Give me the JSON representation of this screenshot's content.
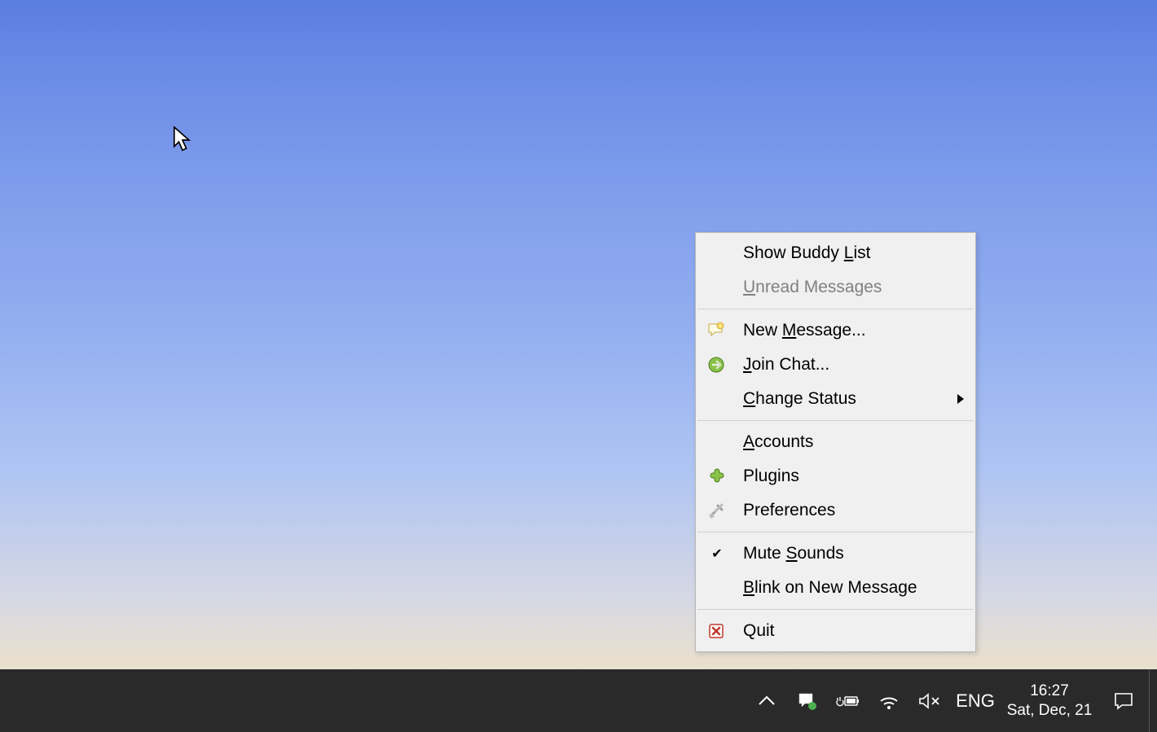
{
  "menu": {
    "items": [
      {
        "label": "Show Buddy List",
        "underline": "L",
        "icon": null,
        "disabled": false,
        "check": false,
        "submenu": false
      },
      {
        "label": "Unread Messages",
        "underline": "U",
        "icon": null,
        "disabled": true,
        "check": false,
        "submenu": false
      },
      {
        "sep": true
      },
      {
        "label": "New Message...",
        "underline": "M",
        "icon": "new-message",
        "disabled": false,
        "check": false,
        "submenu": false
      },
      {
        "label": "Join Chat...",
        "underline": "J",
        "icon": "join-chat",
        "disabled": false,
        "check": false,
        "submenu": false
      },
      {
        "label": "Change Status",
        "underline": "C",
        "icon": null,
        "disabled": false,
        "check": false,
        "submenu": true
      },
      {
        "sep": true
      },
      {
        "label": "Accounts",
        "underline": "A",
        "icon": null,
        "disabled": false,
        "check": false,
        "submenu": false
      },
      {
        "label": "Plugins",
        "underline": "",
        "icon": "plugin",
        "disabled": false,
        "check": false,
        "submenu": false
      },
      {
        "label": "Preferences",
        "underline": "",
        "icon": "preferences",
        "disabled": false,
        "check": false,
        "submenu": false
      },
      {
        "sep": true
      },
      {
        "label": "Mute Sounds",
        "underline": "S",
        "icon": null,
        "disabled": false,
        "check": true,
        "submenu": false
      },
      {
        "label": "Blink on New Message",
        "underline": "B",
        "icon": null,
        "disabled": false,
        "check": false,
        "submenu": false
      },
      {
        "sep": true
      },
      {
        "label": "Quit",
        "underline": "",
        "icon": "quit",
        "disabled": false,
        "check": false,
        "submenu": false
      }
    ]
  },
  "taskbar": {
    "language": "ENG",
    "time": "16:27",
    "date": "Sat, Dec, 21"
  }
}
